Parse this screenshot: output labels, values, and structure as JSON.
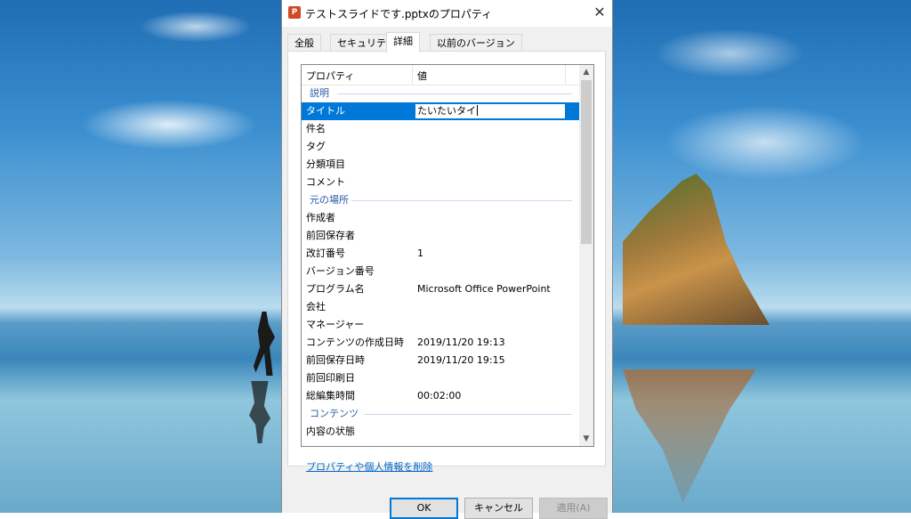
{
  "dialog": {
    "title": "テストスライドです.pptxのプロパティ",
    "icon": "P",
    "close_label": "✕"
  },
  "tabs": [
    {
      "label": "全般"
    },
    {
      "label": "セキュリティ"
    },
    {
      "label": "詳細"
    },
    {
      "label": "以前のバージョン"
    }
  ],
  "list": {
    "header": {
      "name": "プロパティ",
      "value": "値"
    },
    "groups": {
      "description": "説明",
      "origin": "元の場所",
      "content": "コンテンツ"
    },
    "rows": {
      "title": {
        "name": "タイトル",
        "value": "たいたいタイ"
      },
      "subject": {
        "name": "件名",
        "value": ""
      },
      "tags": {
        "name": "タグ",
        "value": ""
      },
      "categories": {
        "name": "分類項目",
        "value": ""
      },
      "comments": {
        "name": "コメント",
        "value": ""
      },
      "authors": {
        "name": "作成者",
        "value": ""
      },
      "last_saved_by": {
        "name": "前回保存者",
        "value": ""
      },
      "revision": {
        "name": "改訂番号",
        "value": "1"
      },
      "version": {
        "name": "バージョン番号",
        "value": ""
      },
      "program": {
        "name": "プログラム名",
        "value": "Microsoft Office PowerPoint"
      },
      "company": {
        "name": "会社",
        "value": ""
      },
      "manager": {
        "name": "マネージャー",
        "value": ""
      },
      "content_created": {
        "name": "コンテンツの作成日時",
        "value": "2019/11/20 19:13"
      },
      "date_saved": {
        "name": "前回保存日時",
        "value": "2019/11/20 19:15"
      },
      "last_printed": {
        "name": "前回印刷日",
        "value": ""
      },
      "total_editing": {
        "name": "総編集時間",
        "value": "00:02:00"
      },
      "content_status": {
        "name": "内容の状態",
        "value": ""
      }
    }
  },
  "remove_link": "プロパティや個人情報を削除",
  "buttons": {
    "ok": "OK",
    "cancel": "キャンセル",
    "apply": "適用(A)"
  },
  "colors": {
    "selection": "#0078d7",
    "group_header": "#2a5aa5",
    "link": "#0066cc"
  }
}
